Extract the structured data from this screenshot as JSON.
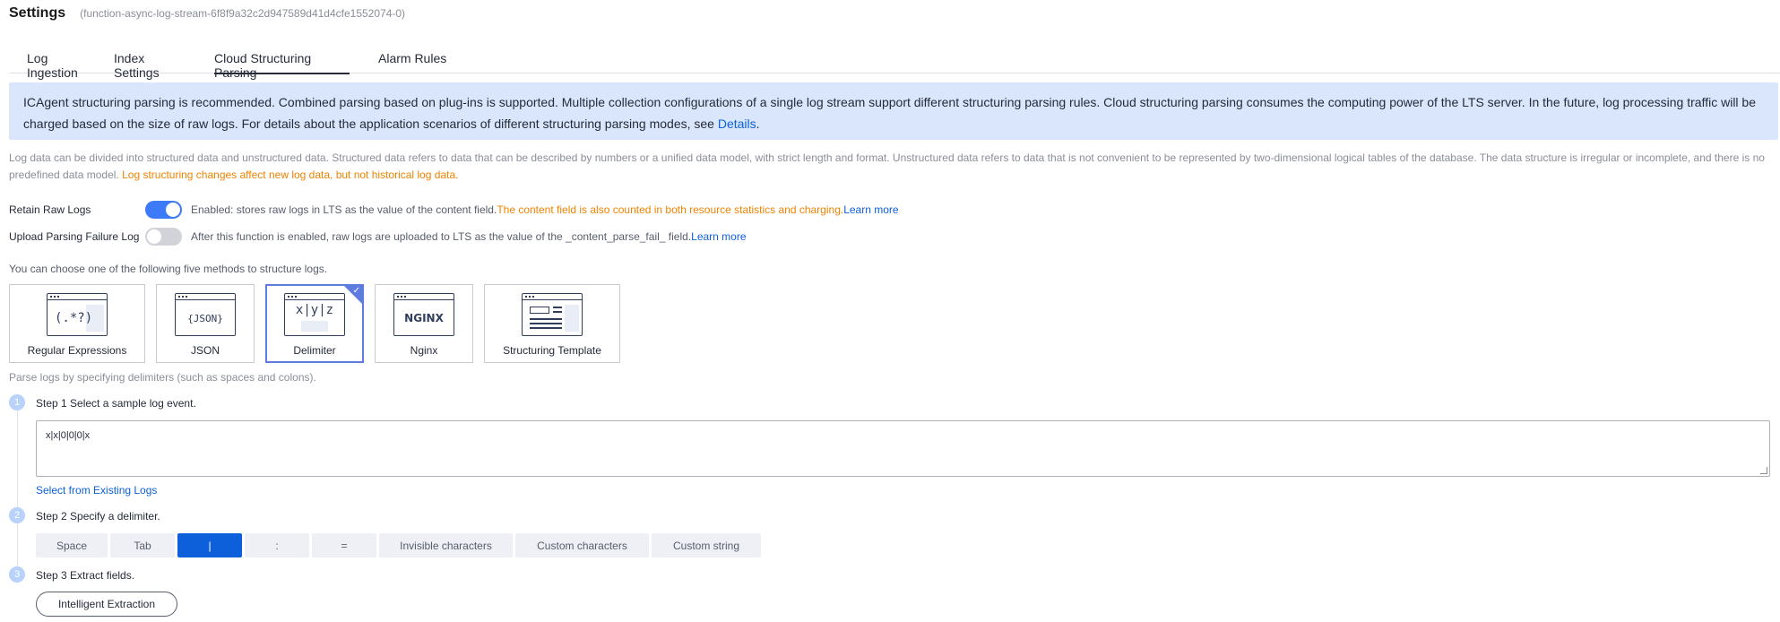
{
  "header": {
    "title": "Settings",
    "subtitle": "(function-async-log-stream-6f8f9a32c2d947589d41d4cfe1552074-0)"
  },
  "tabs": [
    {
      "label": "Log Ingestion"
    },
    {
      "label": "Index Settings"
    },
    {
      "label": "Cloud Structuring Parsing",
      "active": true
    },
    {
      "label": "Alarm Rules"
    }
  ],
  "notice": {
    "text": "ICAgent structuring parsing is recommended. Combined parsing based on plug-ins is supported. Multiple collection configurations of a single log stream support different structuring parsing rules. Cloud structuring parsing consumes the computing power of the LTS server. In the future, log processing traffic will be charged based on the size of raw logs. For details about the application scenarios of different structuring parsing modes, see ",
    "link": "Details",
    "tail": "."
  },
  "description": {
    "text": "Log data can be divided into structured data and unstructured data. Structured data refers to data that can be described by numbers or a unified data model, with strict length and format. Unstructured data refers to data that is not convenient to be represented by two-dimensional logical tables of the database. The data structure is irregular or incomplete, and there is no predefined data model. ",
    "warning": "Log structuring changes affect new log data, but not historical log data."
  },
  "retain_raw_logs": {
    "label": "Retain Raw Logs",
    "enabled": true,
    "hint": "Enabled: stores raw logs in LTS as the value of the content field.",
    "warning": "The content field is also counted in both resource statistics and charging.",
    "link": "Learn more"
  },
  "upload_failure_log": {
    "label": "Upload Parsing Failure Log",
    "enabled": false,
    "hint": "After this function is enabled, raw logs are uploaded to LTS as the value of the _content_parse_fail_ field.",
    "link": "Learn more"
  },
  "methods": {
    "title": "You can choose one of the following five methods to structure logs.",
    "items": [
      {
        "label": "Regular Expressions",
        "glyph": "(.*?)",
        "icon": "regex-icon"
      },
      {
        "label": "JSON",
        "glyph": "{JSON}",
        "icon": "json-icon"
      },
      {
        "label": "Delimiter",
        "glyph": "x|y|z",
        "icon": "delimiter-icon",
        "selected": true
      },
      {
        "label": "Nginx",
        "glyph": "NGINX",
        "icon": "nginx-icon"
      },
      {
        "label": "Structuring Template",
        "glyph": "",
        "icon": "template-icon"
      }
    ]
  },
  "parse_desc": "Parse logs by specifying delimiters (such as spaces and colons).",
  "steps": {
    "step1": {
      "num": "1",
      "label": "Step 1 Select a sample log event."
    },
    "step2": {
      "num": "2",
      "label": "Step 2 Specify a delimiter."
    },
    "step3": {
      "num": "3",
      "label": "Step 3 Extract fields."
    }
  },
  "sample_log": "x|x|0|0|0|x",
  "select_existing": "Select from Existing Logs",
  "delimiters": [
    {
      "label": "Space"
    },
    {
      "label": "Tab"
    },
    {
      "label": "|",
      "active": true
    },
    {
      "label": ":"
    },
    {
      "label": "="
    },
    {
      "label": "Invisible characters"
    },
    {
      "label": "Custom characters"
    },
    {
      "label": "Custom string"
    }
  ],
  "extract_button": "Intelligent Extraction",
  "colors": {
    "accent": "#0d60d9",
    "switch_on": "#3c7af7",
    "warning": "#f08300",
    "notice_bg": "#d9e6fc"
  }
}
